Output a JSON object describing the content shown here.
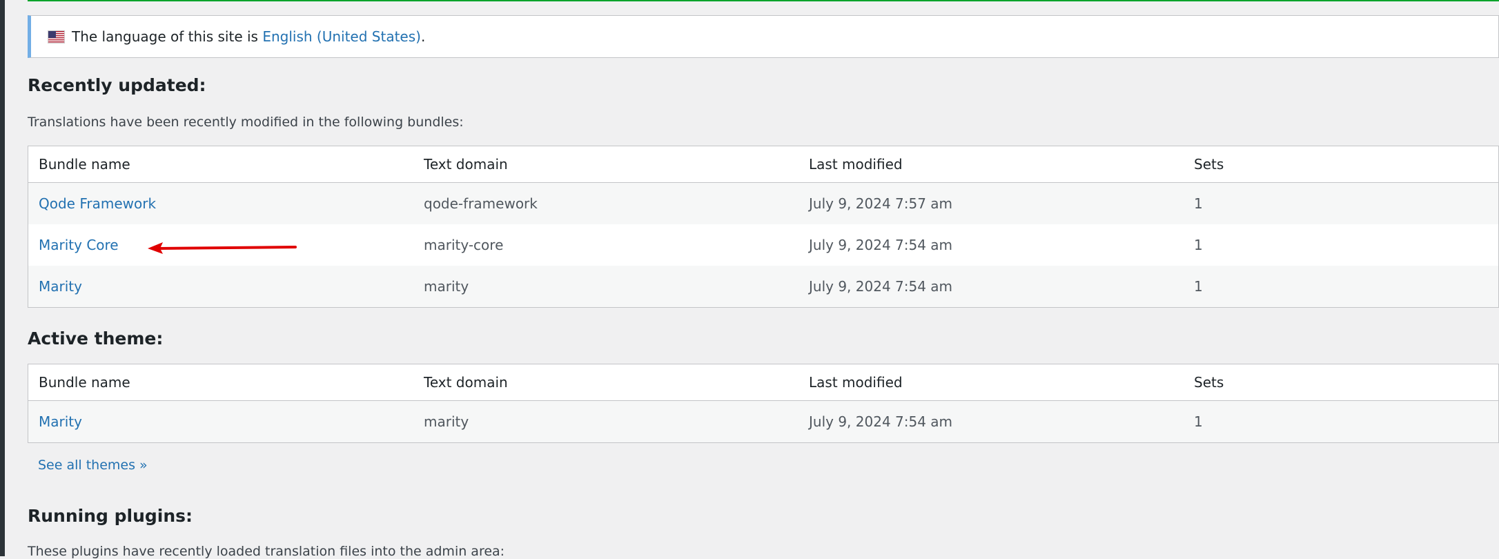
{
  "notice": {
    "prefix": "The language of this site is ",
    "language_link": "English (United States)",
    "suffix": "."
  },
  "recent": {
    "heading": "Recently updated:",
    "description": "Translations have been recently modified in the following bundles:",
    "columns": [
      "Bundle name",
      "Text domain",
      "Last modified",
      "Sets"
    ],
    "rows": [
      {
        "name": "Qode Framework",
        "domain": "qode-framework",
        "modified": "July 9, 2024 7:57 am",
        "sets": "1"
      },
      {
        "name": "Marity Core",
        "domain": "marity-core",
        "modified": "July 9, 2024 7:54 am",
        "sets": "1"
      },
      {
        "name": "Marity",
        "domain": "marity",
        "modified": "July 9, 2024 7:54 am",
        "sets": "1"
      }
    ]
  },
  "theme": {
    "heading": "Active theme:",
    "columns": [
      "Bundle name",
      "Text domain",
      "Last modified",
      "Sets"
    ],
    "rows": [
      {
        "name": "Marity",
        "domain": "marity",
        "modified": "July 9, 2024 7:54 am",
        "sets": "1"
      }
    ],
    "see_all": "See all themes »"
  },
  "plugins": {
    "heading": "Running plugins:",
    "description": "These plugins have recently loaded translation files into the admin area:"
  },
  "colors": {
    "accent": "#2271b1",
    "annotation_arrow": "#e00000",
    "notice_border": "#72aee6"
  }
}
